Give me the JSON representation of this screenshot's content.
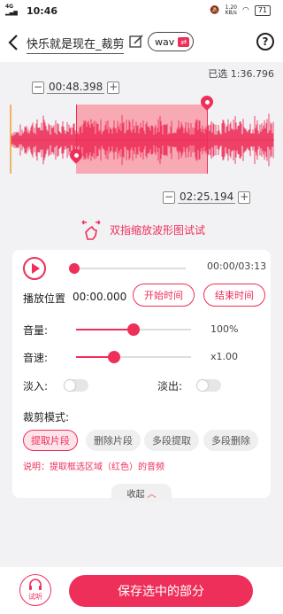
{
  "status_bar": {
    "time": "10:46",
    "network": "4G",
    "speed_value": "1.20",
    "speed_unit": "KB/s",
    "battery": "71"
  },
  "header": {
    "title": "快乐就是现在_裁剪",
    "format_label": "wav",
    "help_label": "?"
  },
  "selection": {
    "selected_label": "已选",
    "selected_duration": "1:36.796"
  },
  "markers": {
    "start_time": "00:48.398",
    "end_time": "02:25.194",
    "minus": "−",
    "plus": "+"
  },
  "gesture_hint": "双指缩放波形图试试",
  "player": {
    "current_time": "00:00",
    "total_time": "03:13",
    "position_label": "播放位置",
    "position_value": "00:00.000",
    "start_time_button": "开始时间",
    "end_time_button": "结束时间",
    "progress": 0
  },
  "controls": {
    "volume_label": "音量:",
    "volume_value": "100%",
    "volume_fraction": 0.5,
    "speed_label": "音速:",
    "speed_value": "x1.00",
    "speed_fraction": 0.33,
    "fade_in_label": "淡入:",
    "fade_out_label": "淡出:",
    "fade_in_on": false,
    "fade_out_on": false
  },
  "cut_mode": {
    "title": "裁剪模式:",
    "options": [
      "提取片段",
      "删除片段",
      "多段提取",
      "多段删除"
    ],
    "selected_index": 0,
    "description": "说明：提取框选区域（红色）的音频"
  },
  "collapse_label": "收起",
  "bottom": {
    "listen_label": "试听",
    "save_label": "保存选中的部分"
  },
  "colors": {
    "accent": "#ee2f5a",
    "waveform": "#ee2f5a",
    "selection_fill": "#f7a9b4",
    "playhead": "#f0a030"
  }
}
